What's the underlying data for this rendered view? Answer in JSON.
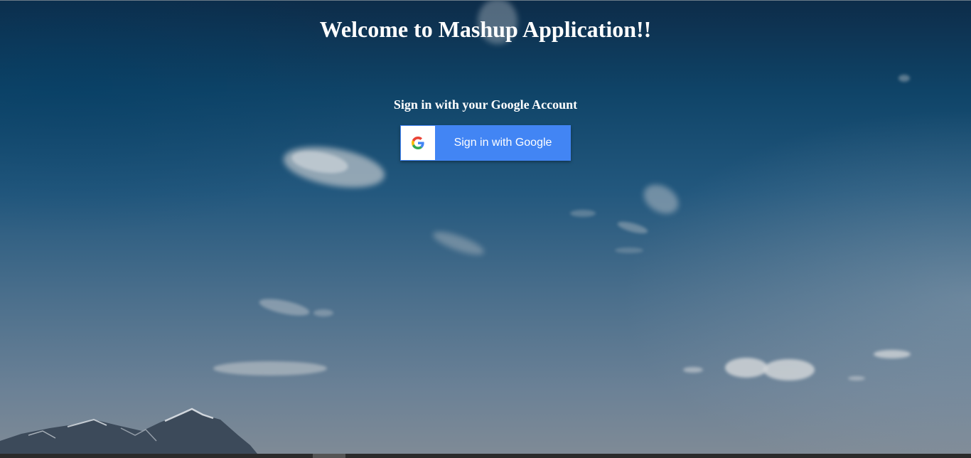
{
  "page": {
    "title": "Welcome to Mashup Application!!",
    "subtitle": "Sign in with your Google Account"
  },
  "signin": {
    "button_label": "Sign in with Google",
    "icon": "google-g-icon"
  },
  "colors": {
    "button_bg": "#4285f4",
    "text": "#ffffff",
    "sky_top": "#0d2c49",
    "sky_bottom": "#808b96"
  }
}
